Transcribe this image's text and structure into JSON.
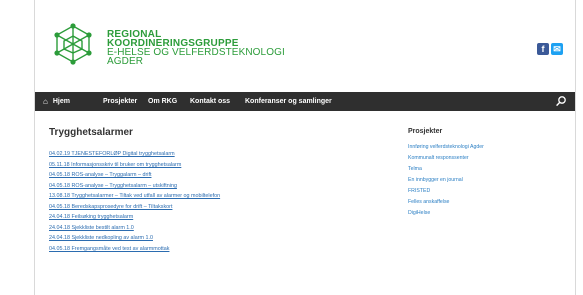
{
  "brand": {
    "line1": "REGIONAL",
    "line2": "KOORDINERINGSGRUPPE",
    "line3": "E-HELSE OG VELFERDSTEKNOLOGI",
    "line4": "AGDER"
  },
  "social": {
    "facebook_glyph": "f",
    "facebook_icon": "facebook-icon",
    "mail_icon": "mail-icon",
    "mail_glyph": "✉"
  },
  "nav": {
    "home_glyph": "⌂",
    "home": "Hjem",
    "items": [
      "Prosjekter",
      "Om RKG",
      "Kontakt oss",
      "Konferanser og samlinger"
    ],
    "search_icon": "search-icon"
  },
  "main": {
    "title": "Trygghetsalarmer",
    "links": [
      "04.02.19 TJENESTEFORLØP Digital trygghetsalarm",
      "05.11.18 Informasjonsskriv til bruker om trygghetsalarm",
      "04.05.18 ROS-analyse – Tryggalarm – drift",
      "04.05.18 ROS-analyse – Trygghetsalarm – utskiftning",
      "13.08.18 Trygghetsalarmer – Tiltak ved utfall av alarmer og mobiltelefon",
      "04.05.18 Beredskapsprosedyre for drift – Tiltakskort",
      "24.04.18 Feilsøking trygghetsalarm",
      "24.04.18 Sjekkliste bestilt alarm 1.0",
      "24.04.18 Sjekkliste nedkopling av alarm 1.0",
      "04.05.18 Fremgangsmåte ved test av alarmmottak"
    ]
  },
  "sidebar": {
    "title": "Prosjekter",
    "items": [
      "Innføring velferdsteknologi Agder",
      "Kommunalt responssenter",
      "Telma",
      "En innbygger en journal",
      "FRISTED",
      "Felles anskaffelse",
      "DigiHelse"
    ]
  },
  "colors": {
    "brand_green": "#2c9c3a",
    "nav_bg": "#2f2f2f",
    "link_blue": "#2b6cb0"
  }
}
